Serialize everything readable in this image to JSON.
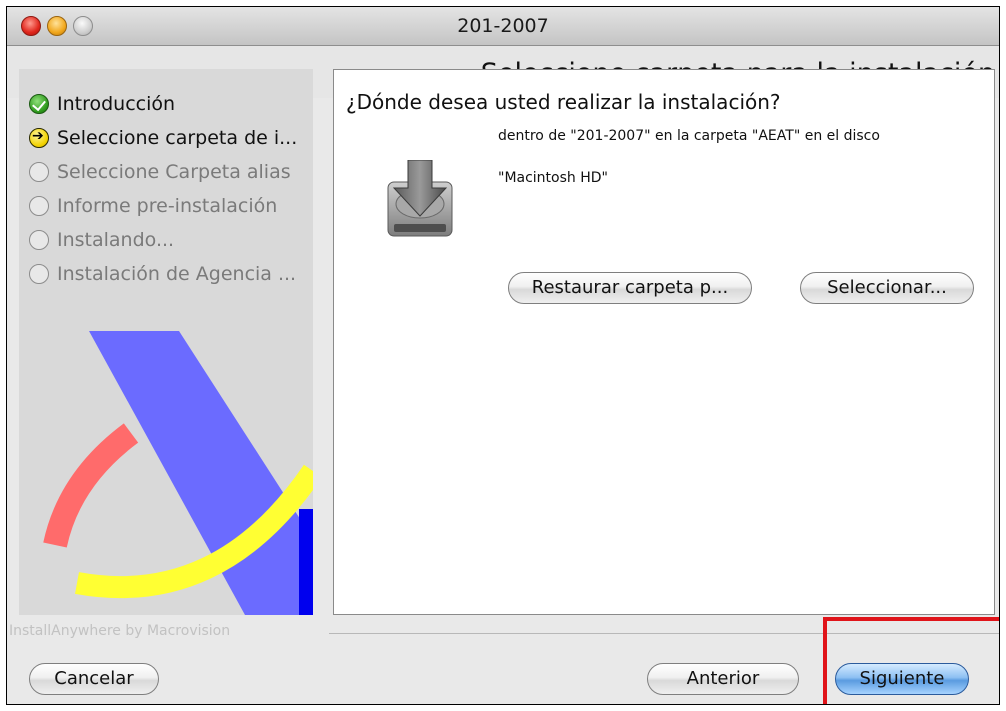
{
  "window": {
    "title": "201-2007"
  },
  "header": {
    "title": "Seleccione carpeta para la instalación"
  },
  "sidebar": {
    "steps": [
      {
        "label": "Introducción",
        "state": "done",
        "icon": "check-circle-icon"
      },
      {
        "label": "Seleccione carpeta de i...",
        "state": "current",
        "icon": "arrow-circle-icon"
      },
      {
        "label": "Seleccione  Carpeta alias",
        "state": "todo",
        "icon": "empty-circle-icon"
      },
      {
        "label": "Informe pre-instalación",
        "state": "todo",
        "icon": "empty-circle-icon"
      },
      {
        "label": "Instalando...",
        "state": "todo",
        "icon": "empty-circle-icon"
      },
      {
        "label": "Instalación de Agencia ...",
        "state": "todo",
        "icon": "empty-circle-icon"
      }
    ],
    "logo_colors": {
      "blue": "#6b6bff",
      "red": "#ff6b6b",
      "yellow": "#ffff33",
      "dark_blue": "#0000ee"
    }
  },
  "main": {
    "question": "¿Dónde desea usted realizar la instalación?",
    "destination_line1": "dentro de \"201-2007\" en la carpeta \"AEAT\" en el disco",
    "destination_line2": "\"Macintosh HD\"",
    "icon": "hard-drive-install-icon",
    "restore_button": "Restaurar carpeta p...",
    "select_button": "Seleccionar..."
  },
  "footer": {
    "brand": "InstallAnywhere by Macrovision",
    "cancel_button": "Cancelar",
    "previous_button": "Anterior",
    "next_button": "Siguiente"
  },
  "colors": {
    "highlight": "#e0141a",
    "default_button": "#5a9be0"
  }
}
